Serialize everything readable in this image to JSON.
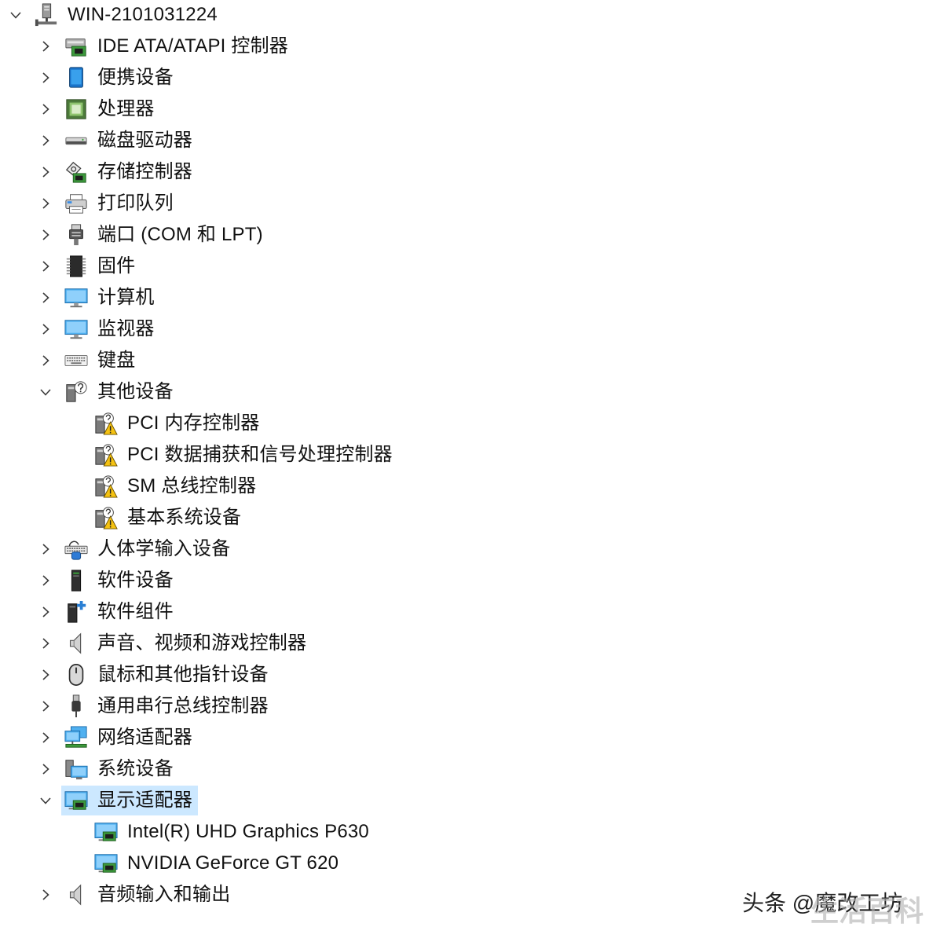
{
  "tree": {
    "root": {
      "label": "WIN-2101031224",
      "icon": "computer-network-icon",
      "expanded": true
    },
    "items": [
      {
        "label": "IDE ATA/ATAPI 控制器",
        "icon": "ide-controller-icon",
        "expanded": false
      },
      {
        "label": "便携设备",
        "icon": "portable-device-icon",
        "expanded": false
      },
      {
        "label": "处理器",
        "icon": "processor-icon",
        "expanded": false
      },
      {
        "label": "磁盘驱动器",
        "icon": "disk-drive-icon",
        "expanded": false
      },
      {
        "label": "存储控制器",
        "icon": "storage-controller-icon",
        "expanded": false
      },
      {
        "label": "打印队列",
        "icon": "printer-icon",
        "expanded": false
      },
      {
        "label": "端口 (COM 和 LPT)",
        "icon": "port-connector-icon",
        "expanded": false
      },
      {
        "label": "固件",
        "icon": "firmware-chip-icon",
        "expanded": false
      },
      {
        "label": "计算机",
        "icon": "computer-monitor-icon",
        "expanded": false
      },
      {
        "label": "监视器",
        "icon": "monitor-icon",
        "expanded": false
      },
      {
        "label": "键盘",
        "icon": "keyboard-icon",
        "expanded": false
      },
      {
        "label": "其他设备",
        "icon": "unknown-device-icon",
        "expanded": true,
        "children": [
          {
            "label": "PCI 内存控制器",
            "icon": "device-warning-icon"
          },
          {
            "label": "PCI 数据捕获和信号处理控制器",
            "icon": "device-warning-icon"
          },
          {
            "label": "SM 总线控制器",
            "icon": "device-warning-icon"
          },
          {
            "label": "基本系统设备",
            "icon": "device-warning-icon"
          }
        ]
      },
      {
        "label": "人体学输入设备",
        "icon": "human-interface-device-icon",
        "expanded": false
      },
      {
        "label": "软件设备",
        "icon": "software-device-icon",
        "expanded": false
      },
      {
        "label": "软件组件",
        "icon": "software-component-icon",
        "expanded": false
      },
      {
        "label": "声音、视频和游戏控制器",
        "icon": "speaker-icon",
        "expanded": false
      },
      {
        "label": "鼠标和其他指针设备",
        "icon": "mouse-icon",
        "expanded": false
      },
      {
        "label": "通用串行总线控制器",
        "icon": "usb-plug-icon",
        "expanded": false
      },
      {
        "label": "网络适配器",
        "icon": "network-adapter-icon",
        "expanded": false
      },
      {
        "label": "系统设备",
        "icon": "system-devices-icon",
        "expanded": false
      },
      {
        "label": "显示适配器",
        "icon": "display-adapter-icon",
        "expanded": true,
        "selected": true,
        "children": [
          {
            "label": "Intel(R) UHD Graphics P630",
            "icon": "display-adapter-icon"
          },
          {
            "label": "NVIDIA GeForce GT 620",
            "icon": "display-adapter-icon"
          }
        ]
      },
      {
        "label": "音频输入和输出",
        "icon": "speaker-icon",
        "expanded": false
      }
    ]
  },
  "watermark": {
    "source": "头条 @魔改工坊",
    "overlay": "生活百科"
  },
  "colors": {
    "background": "#ffffff",
    "text": "#111111",
    "selection_background": "#cce8ff"
  }
}
